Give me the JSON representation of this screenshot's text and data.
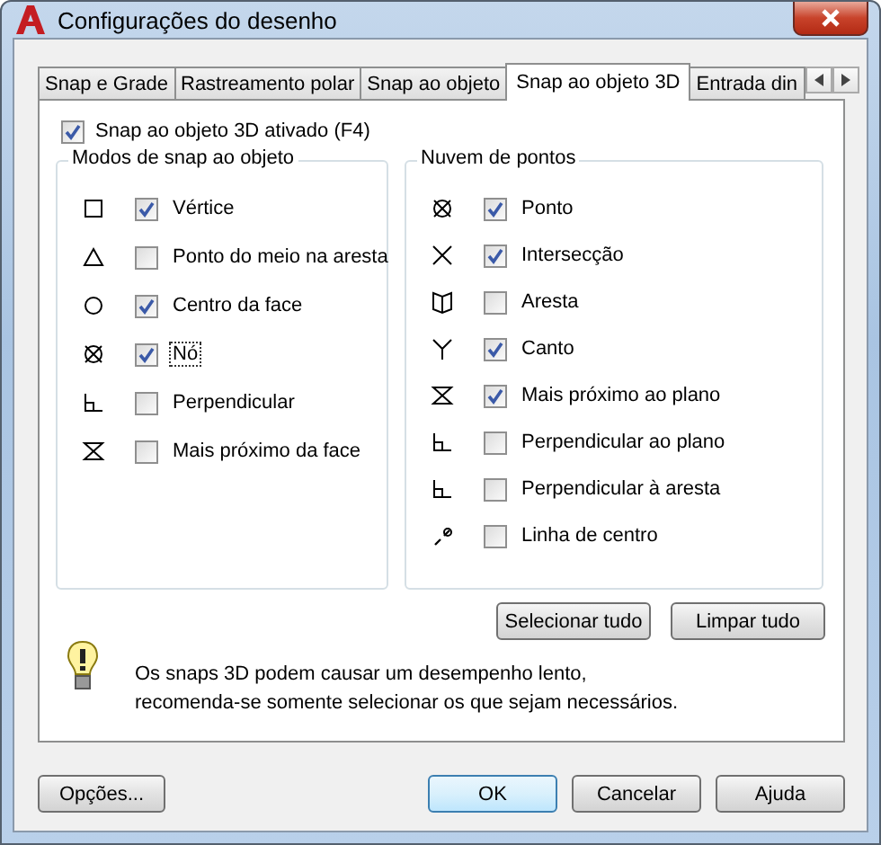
{
  "window": {
    "title": "Configurações do desenho"
  },
  "tabs": [
    {
      "label": "Snap e Grade",
      "selected": false
    },
    {
      "label": "Rastreamento polar",
      "selected": false
    },
    {
      "label": "Snap ao objeto",
      "selected": false
    },
    {
      "label": "Snap ao objeto 3D",
      "selected": true
    },
    {
      "label": "Entrada din",
      "selected": false
    }
  ],
  "master": {
    "label": "Snap ao objeto 3D ativado (F4)",
    "checked": true
  },
  "groups": [
    {
      "title": "Modos de snap ao objeto",
      "items": [
        {
          "kind": "square",
          "label": "Vértice",
          "checked": true,
          "focused": false
        },
        {
          "kind": "triangle",
          "label": "Ponto do meio na aresta",
          "checked": false,
          "focused": false
        },
        {
          "kind": "circle",
          "label": "Centro da face",
          "checked": true,
          "focused": false
        },
        {
          "kind": "node",
          "label": "Nó",
          "checked": true,
          "focused": true
        },
        {
          "kind": "perpendicular",
          "label": "Perpendicular",
          "checked": false,
          "focused": false
        },
        {
          "kind": "nearest",
          "label": "Mais próximo da face",
          "checked": false,
          "focused": false
        }
      ]
    },
    {
      "title": "Nuvem de pontos",
      "items": [
        {
          "kind": "node",
          "label": "Ponto",
          "checked": true,
          "focused": false
        },
        {
          "kind": "intersection",
          "label": "Intersecção",
          "checked": true,
          "focused": false
        },
        {
          "kind": "edge",
          "label": "Aresta",
          "checked": false,
          "focused": false
        },
        {
          "kind": "corner",
          "label": "Canto",
          "checked": true,
          "focused": false
        },
        {
          "kind": "nearest",
          "label": "Mais próximo ao plano",
          "checked": true,
          "focused": false
        },
        {
          "kind": "perpendicular",
          "label": "Perpendicular ao plano",
          "checked": false,
          "focused": false
        },
        {
          "kind": "perpendicular",
          "label": "Perpendicular à aresta",
          "checked": false,
          "focused": false
        },
        {
          "kind": "centerline",
          "label": "Linha de centro",
          "checked": false,
          "focused": false
        }
      ]
    }
  ],
  "group_buttons": [
    "Selecionar tudo",
    "Limpar tudo"
  ],
  "note": "Os snaps 3D podem causar um desempenho lento,\nrecomenda-se somente selecionar os que sejam necessários.",
  "footer": {
    "left": "Opções...",
    "buttons": [
      {
        "label": "OK",
        "default": true
      },
      {
        "label": "Cancelar",
        "default": false
      },
      {
        "label": "Ajuda",
        "default": false
      }
    ]
  }
}
